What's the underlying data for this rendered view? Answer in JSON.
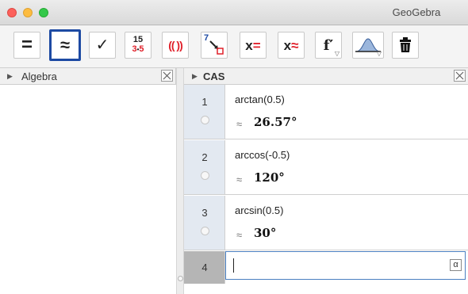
{
  "window": {
    "title": "GeoGebra"
  },
  "toolbar": {
    "buttons": [
      {
        "name": "evaluate-tool",
        "label": "="
      },
      {
        "name": "numeric-tool",
        "label": "≈"
      },
      {
        "name": "keep-input-tool",
        "label": "✓"
      },
      {
        "name": "factor-tool",
        "label_top": "15",
        "label_bottom_a": "3",
        "label_bottom_dot": "•",
        "label_bottom_b": "5"
      },
      {
        "name": "expand-tool",
        "label": "(( ))"
      },
      {
        "name": "substitute-tool",
        "label": "7"
      },
      {
        "name": "solve-tool",
        "label_x": "x",
        "label_sym": "="
      },
      {
        "name": "solve-numerically-tool",
        "label_x": "x",
        "label_sym": "≈"
      },
      {
        "name": "derivative-tool",
        "label": "f′"
      },
      {
        "name": "probability-calculator-tool",
        "label": ""
      },
      {
        "name": "delete-tool",
        "label": ""
      }
    ],
    "accent_color": "#1d4aa3",
    "red_color": "#e0202a"
  },
  "algebra": {
    "title": "Algebra"
  },
  "cas": {
    "title": "CAS",
    "rows": [
      {
        "number": "1",
        "input": "arctan(0.5)",
        "approx": "≈",
        "output": "26.57°"
      },
      {
        "number": "2",
        "input": "arccos(-0.5)",
        "approx": "≈",
        "output": "120°"
      },
      {
        "number": "3",
        "input": "arcsin(0.5)",
        "approx": "≈",
        "output": "30°"
      }
    ],
    "active_row": {
      "number": "4",
      "value": "",
      "alpha_label": "α"
    }
  }
}
